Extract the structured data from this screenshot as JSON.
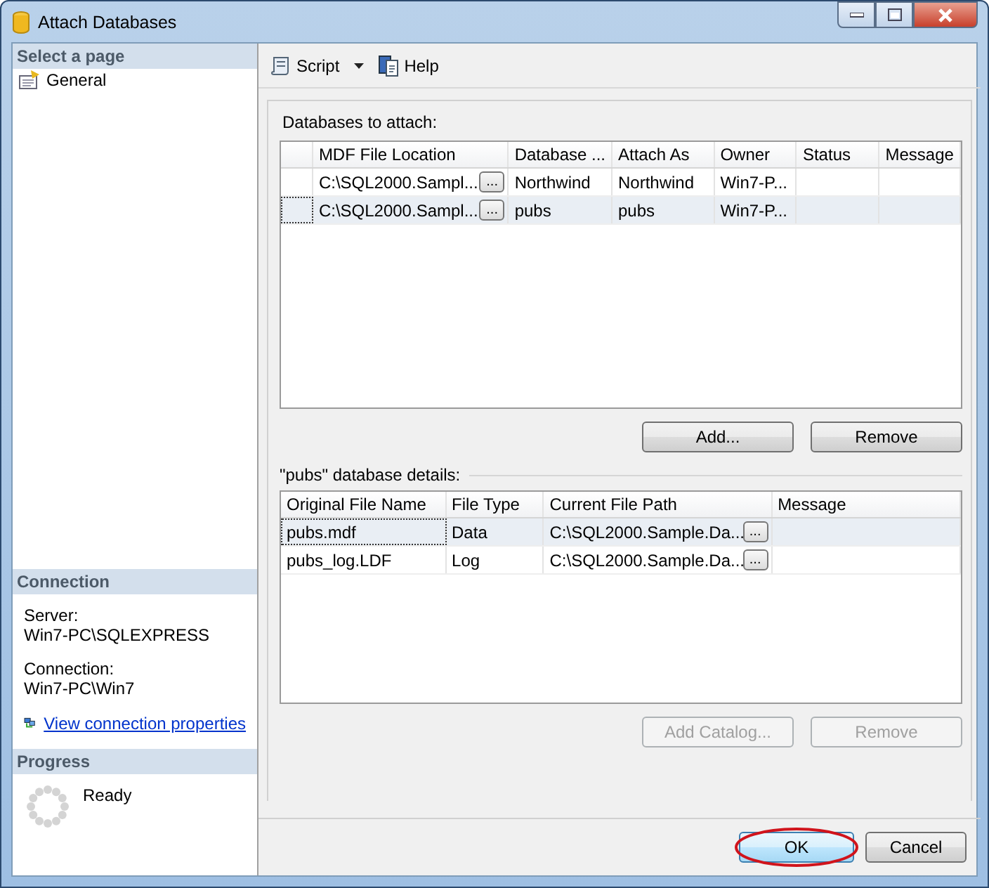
{
  "window": {
    "title": "Attach Databases"
  },
  "sidebar": {
    "heading": "Select a page",
    "items": [
      {
        "label": "General"
      }
    ]
  },
  "connection": {
    "heading": "Connection",
    "server_label": "Server:",
    "server": "Win7-PC\\SQLEXPRESS",
    "connection_label": "Connection:",
    "connection": "Win7-PC\\Win7",
    "link": "View connection properties"
  },
  "progress": {
    "heading": "Progress",
    "status": "Ready"
  },
  "toolbar": [
    {
      "label": "Script",
      "kind": "script"
    },
    {
      "label": "Help",
      "kind": "help"
    }
  ],
  "attach": {
    "label": "Databases to attach:",
    "columns": [
      "MDF File Location",
      "Database ...",
      "Attach As",
      "Owner",
      "Status",
      "Message"
    ],
    "rows": [
      {
        "selected": false,
        "cells": [
          "C:\\SQL2000.Sampl...",
          "Northwind",
          "Northwind",
          "Win7-P...",
          "",
          ""
        ]
      },
      {
        "selected": true,
        "cells": [
          "C:\\SQL2000.Sampl...",
          "pubs",
          "pubs",
          "Win7-P...",
          "",
          ""
        ]
      }
    ],
    "buttons": [
      {
        "label": "Add...",
        "disabled": false
      },
      {
        "label": "Remove",
        "disabled": false
      }
    ]
  },
  "details": {
    "label": "\"pubs\" database details:",
    "columns": [
      "Original File Name",
      "File Type",
      "Current File Path",
      "Message"
    ],
    "rows": [
      {
        "selected": true,
        "cells": [
          "pubs.mdf",
          "Data",
          "C:\\SQL2000.Sample.Da...",
          ""
        ]
      },
      {
        "selected": false,
        "cells": [
          "pubs_log.LDF",
          "Log",
          "C:\\SQL2000.Sample.Da...",
          ""
        ]
      }
    ],
    "buttons": [
      {
        "label": "Add Catalog...",
        "disabled": true
      },
      {
        "label": "Remove",
        "disabled": true
      }
    ]
  },
  "dialog_buttons": [
    {
      "label": "OK",
      "highlighted": true
    },
    {
      "label": "Cancel",
      "highlighted": false
    }
  ],
  "browse_label": "..."
}
